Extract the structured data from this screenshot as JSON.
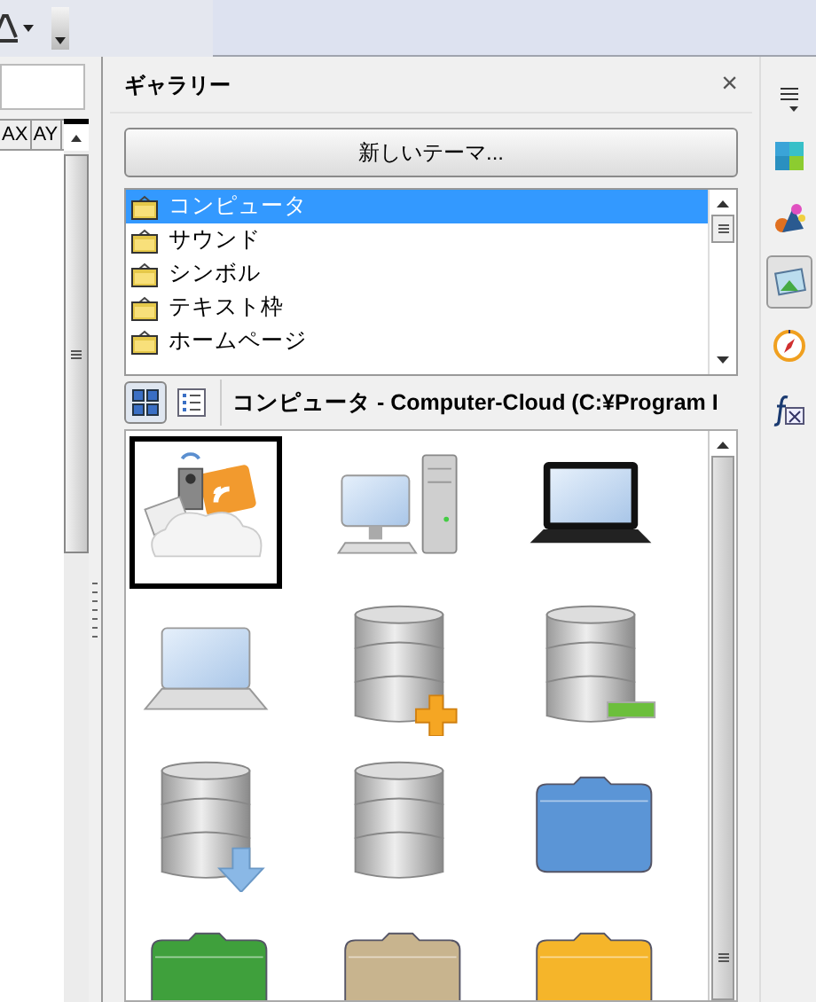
{
  "spreadsheet": {
    "column_headers": [
      "AX",
      "AY"
    ]
  },
  "gallery": {
    "title": "ギャラリー",
    "close": "×",
    "new_theme_button": "新しいテーマ...",
    "themes": [
      {
        "label": "コンピュータ",
        "selected": true
      },
      {
        "label": "サウンド",
        "selected": false
      },
      {
        "label": "シンボル",
        "selected": false
      },
      {
        "label": "テキスト枠",
        "selected": false
      },
      {
        "label": "ホームページ",
        "selected": false
      }
    ],
    "view_buttons": [
      {
        "kind": "icons",
        "selected": true
      },
      {
        "kind": "details",
        "selected": false
      }
    ],
    "path": "コンピュータ - Computer-Cloud (C:¥Program I",
    "items": [
      {
        "kind": "cloud",
        "selected": true
      },
      {
        "kind": "desktop",
        "selected": false
      },
      {
        "kind": "laptop-dark",
        "selected": false
      },
      {
        "kind": "laptop",
        "selected": false
      },
      {
        "kind": "db-add",
        "selected": false
      },
      {
        "kind": "db-remove",
        "selected": false
      },
      {
        "kind": "db-download",
        "selected": false
      },
      {
        "kind": "db",
        "selected": false
      },
      {
        "kind": "folder",
        "color": "#5b95d6",
        "selected": false
      },
      {
        "kind": "folder",
        "color": "#3fa03c",
        "selected": false
      },
      {
        "kind": "folder",
        "color": "#c8b48e",
        "selected": false
      },
      {
        "kind": "folder",
        "color": "#f5b52a",
        "selected": false
      }
    ]
  },
  "deck": [
    {
      "kind": "menu",
      "selected": false
    },
    {
      "kind": "cubes",
      "selected": false
    },
    {
      "kind": "styles",
      "selected": false
    },
    {
      "kind": "gallery",
      "selected": true
    },
    {
      "kind": "navigator",
      "selected": false
    },
    {
      "kind": "functions",
      "selected": false
    }
  ]
}
